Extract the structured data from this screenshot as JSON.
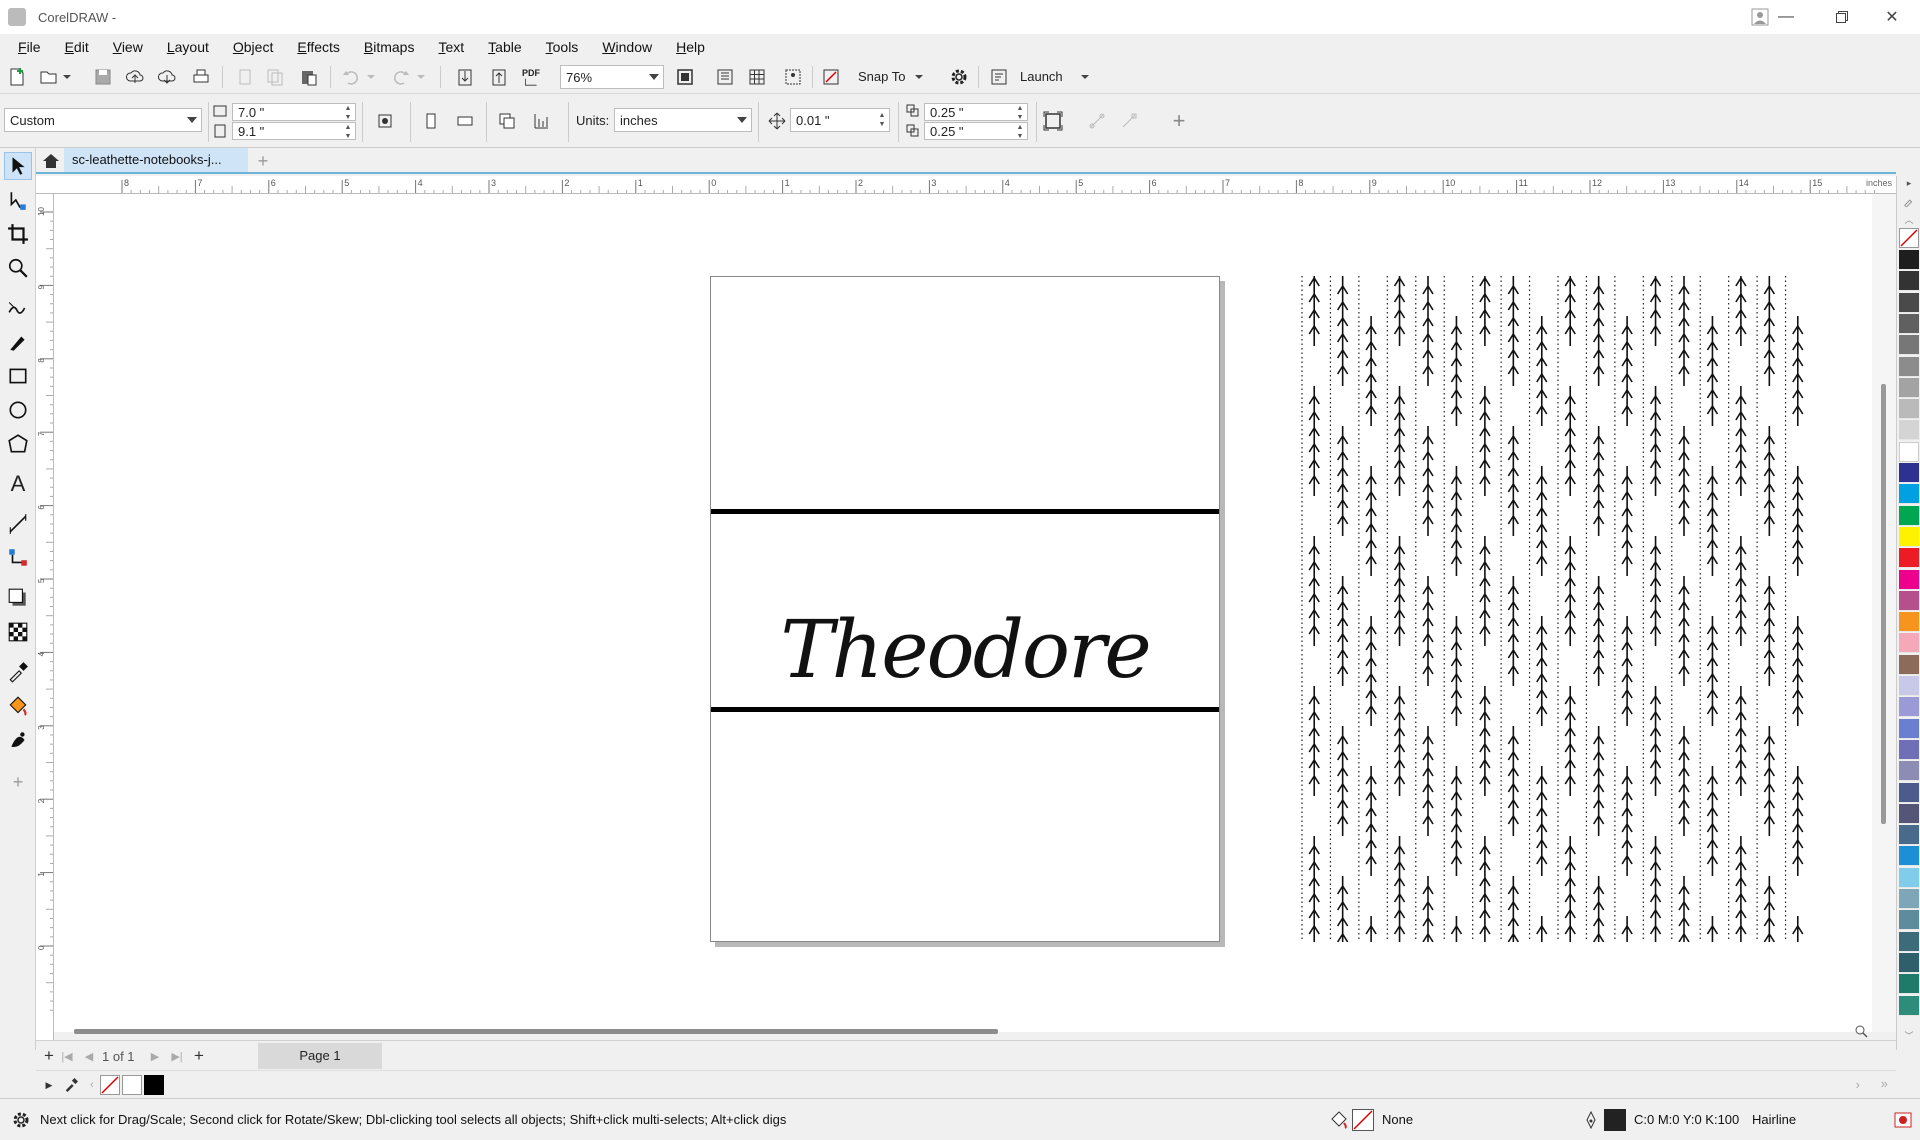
{
  "titlebar": {
    "title": "CorelDRAW -"
  },
  "menubar": {
    "items": [
      "File",
      "Edit",
      "View",
      "Layout",
      "Object",
      "Effects",
      "Bitmaps",
      "Text",
      "Table",
      "Tools",
      "Window",
      "Help"
    ]
  },
  "stdbar": {
    "zoom_value": "76%",
    "pdf_label": "PDF",
    "snap_to_label": "Snap To",
    "launch_label": "Launch"
  },
  "propbar": {
    "page_preset": "Custom",
    "page_width": "7.0 \"",
    "page_height": "9.1 \"",
    "units_label": "Units:",
    "units_value": "inches",
    "nudge_value": "0.01 \"",
    "dup_x": "0.25 \"",
    "dup_y": "0.25 \""
  },
  "document": {
    "tab_label": "sc-leathette-notebooks-j..."
  },
  "rulers": {
    "unit": "inches",
    "h_ticks": [
      "8",
      "7",
      "6",
      "5",
      "4",
      "3",
      "2",
      "1",
      "0",
      "1",
      "2",
      "3",
      "4",
      "5",
      "6",
      "7",
      "8",
      "9",
      "10",
      "11",
      "12",
      "13",
      "14",
      "15"
    ],
    "v_ticks": [
      "10",
      "9",
      "8",
      "7",
      "6",
      "5",
      "4",
      "3",
      "2",
      "1",
      "0"
    ]
  },
  "canvas": {
    "name_text": "Theodore"
  },
  "pagebar": {
    "page_count": "1 of 1",
    "page_tab": "Page 1"
  },
  "statusbar": {
    "hint": "Next click for Drag/Scale; Second click for Rotate/Skew; Dbl-clicking tool selects all objects; Shift+click multi-selects; Alt+click digs",
    "fill_label": "None",
    "outline_color": "C:0 M:0 Y:0 K:100",
    "outline_width": "Hairline"
  },
  "palette_colors": [
    "#1e1e1e",
    "#333333",
    "#4a4a4a",
    "#606060",
    "#777777",
    "#8c8c8c",
    "#a3a3a3",
    "#bababa",
    "#d4d4d4",
    "#ffffff",
    "#2e3192",
    "#00a0e3",
    "#00a650",
    "#fff200",
    "#ed1c24",
    "#ec008c",
    "#b5508c",
    "#f7941d",
    "#f5a9b8",
    "#8c6b5a",
    "#c8c8e8",
    "#9a9ad6",
    "#6a7fd0",
    "#6f6fb8",
    "#8c8cb5",
    "#4b5b8c",
    "#555577",
    "#4a6a8c",
    "#1c8fd6",
    "#7fcdea",
    "#7ea6b8",
    "#5f8c9c",
    "#3e6b7a",
    "#2f5f6a",
    "#1f7a6a",
    "#2d8c7a"
  ]
}
